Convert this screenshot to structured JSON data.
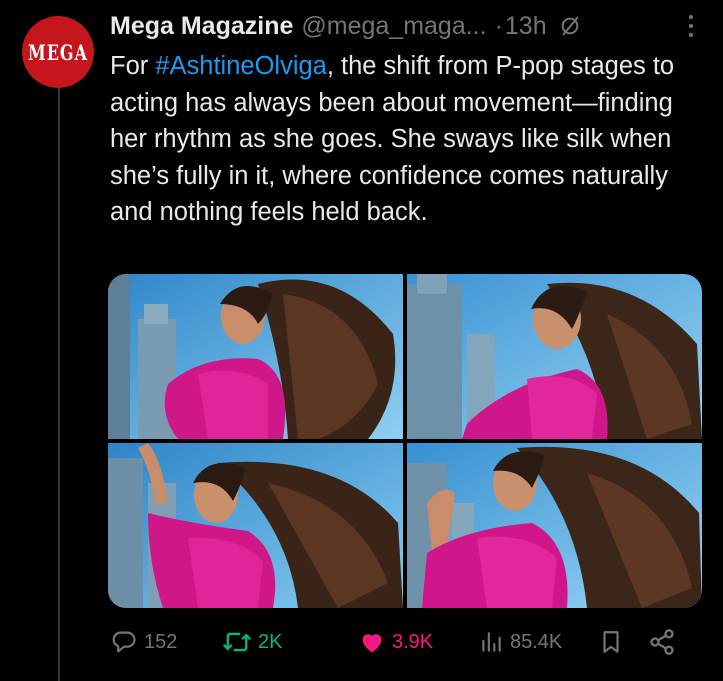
{
  "tweet": {
    "avatar_text": "MEGA",
    "display_name": "Mega Magazine",
    "handle": "@mega_maga...",
    "separator": "·",
    "timestamp": "13h",
    "text_prefix": "For ",
    "hashtag": "#AshtineOlviga",
    "text_body": ", the shift from P-pop stages to acting has always been about movement—finding her rhythm as she goes. She sways like silk when she’s fully in it, where confidence comes naturally and nothing feels held back."
  },
  "media": {
    "photo_count": 4
  },
  "actions": {
    "replies": "152",
    "reposts": "2K",
    "likes": "3.9K",
    "views": "85.4K"
  },
  "colors": {
    "background": "#000000",
    "text": "#e7e9ea",
    "muted": "#71767b",
    "link": "#1d9bf0",
    "repost_active": "#00ba7c",
    "like_active": "#f91880",
    "avatar_red": "#c4161c"
  },
  "icons": {
    "edited": "edited-clock-icon",
    "more": "more-icon",
    "reply": "reply-icon",
    "repost": "repost-icon",
    "like": "heart-icon",
    "views": "views-icon",
    "bookmark": "bookmark-icon",
    "share": "share-icon"
  }
}
